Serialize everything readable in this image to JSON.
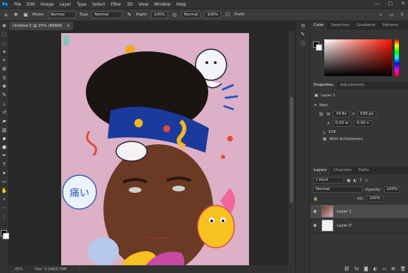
{
  "menubar": {
    "logo": "Ps",
    "items": [
      "File",
      "Edit",
      "Image",
      "Layer",
      "Type",
      "Select",
      "Filter",
      "3D",
      "View",
      "Window",
      "Help"
    ]
  },
  "options": {
    "mode_label": "Mode:",
    "mode_value": "Normal",
    "type_label": "Type",
    "type_value": "Normal",
    "right_label": "Right:",
    "right_value": "100%",
    "blend_value": "Normal",
    "percent_value": "100%",
    "preset_label": "Prefit"
  },
  "document": {
    "tab_label": "Untitled-1 @ 25% (R68/8)",
    "tab_close": "×",
    "zoom": "25%",
    "doc_info": "Doc: 3.24K/3.76M"
  },
  "color_panel": {
    "tabs": [
      "Color",
      "Swatches",
      "Gradients",
      "Patterns"
    ],
    "foreground": "#000000",
    "background": "#ffffff"
  },
  "properties": {
    "tabs": [
      "Properties",
      "Adjustments"
    ],
    "layer_name": "Layer 1",
    "section": "Werl",
    "w_label": "W",
    "w_value": "34.8z",
    "y_label": "Y",
    "y_value": "599 px",
    "x_label": "X",
    "x_value": "0.00 w",
    "x2_value": "0.00 x",
    "exp_label": "EXP",
    "align_label": "Whit Achtelterion"
  },
  "layers_panel": {
    "tabs": [
      "Layers",
      "Channels",
      "Paths"
    ],
    "kind_label": "Kind",
    "blend_mode": "Normal",
    "opacity_label": "Opacity:",
    "opacity_value": "100%",
    "fill_label": "Fill:",
    "fill_value": "100%",
    "layers": [
      {
        "name": "Layer 1",
        "selected": true
      },
      {
        "name": "Layer 0",
        "selected": false
      }
    ],
    "footer_icons": [
      "link-icon",
      "fx-icon",
      "mask-icon",
      "adjustment-icon",
      "group-icon",
      "new-layer-icon",
      "delete-icon"
    ]
  }
}
